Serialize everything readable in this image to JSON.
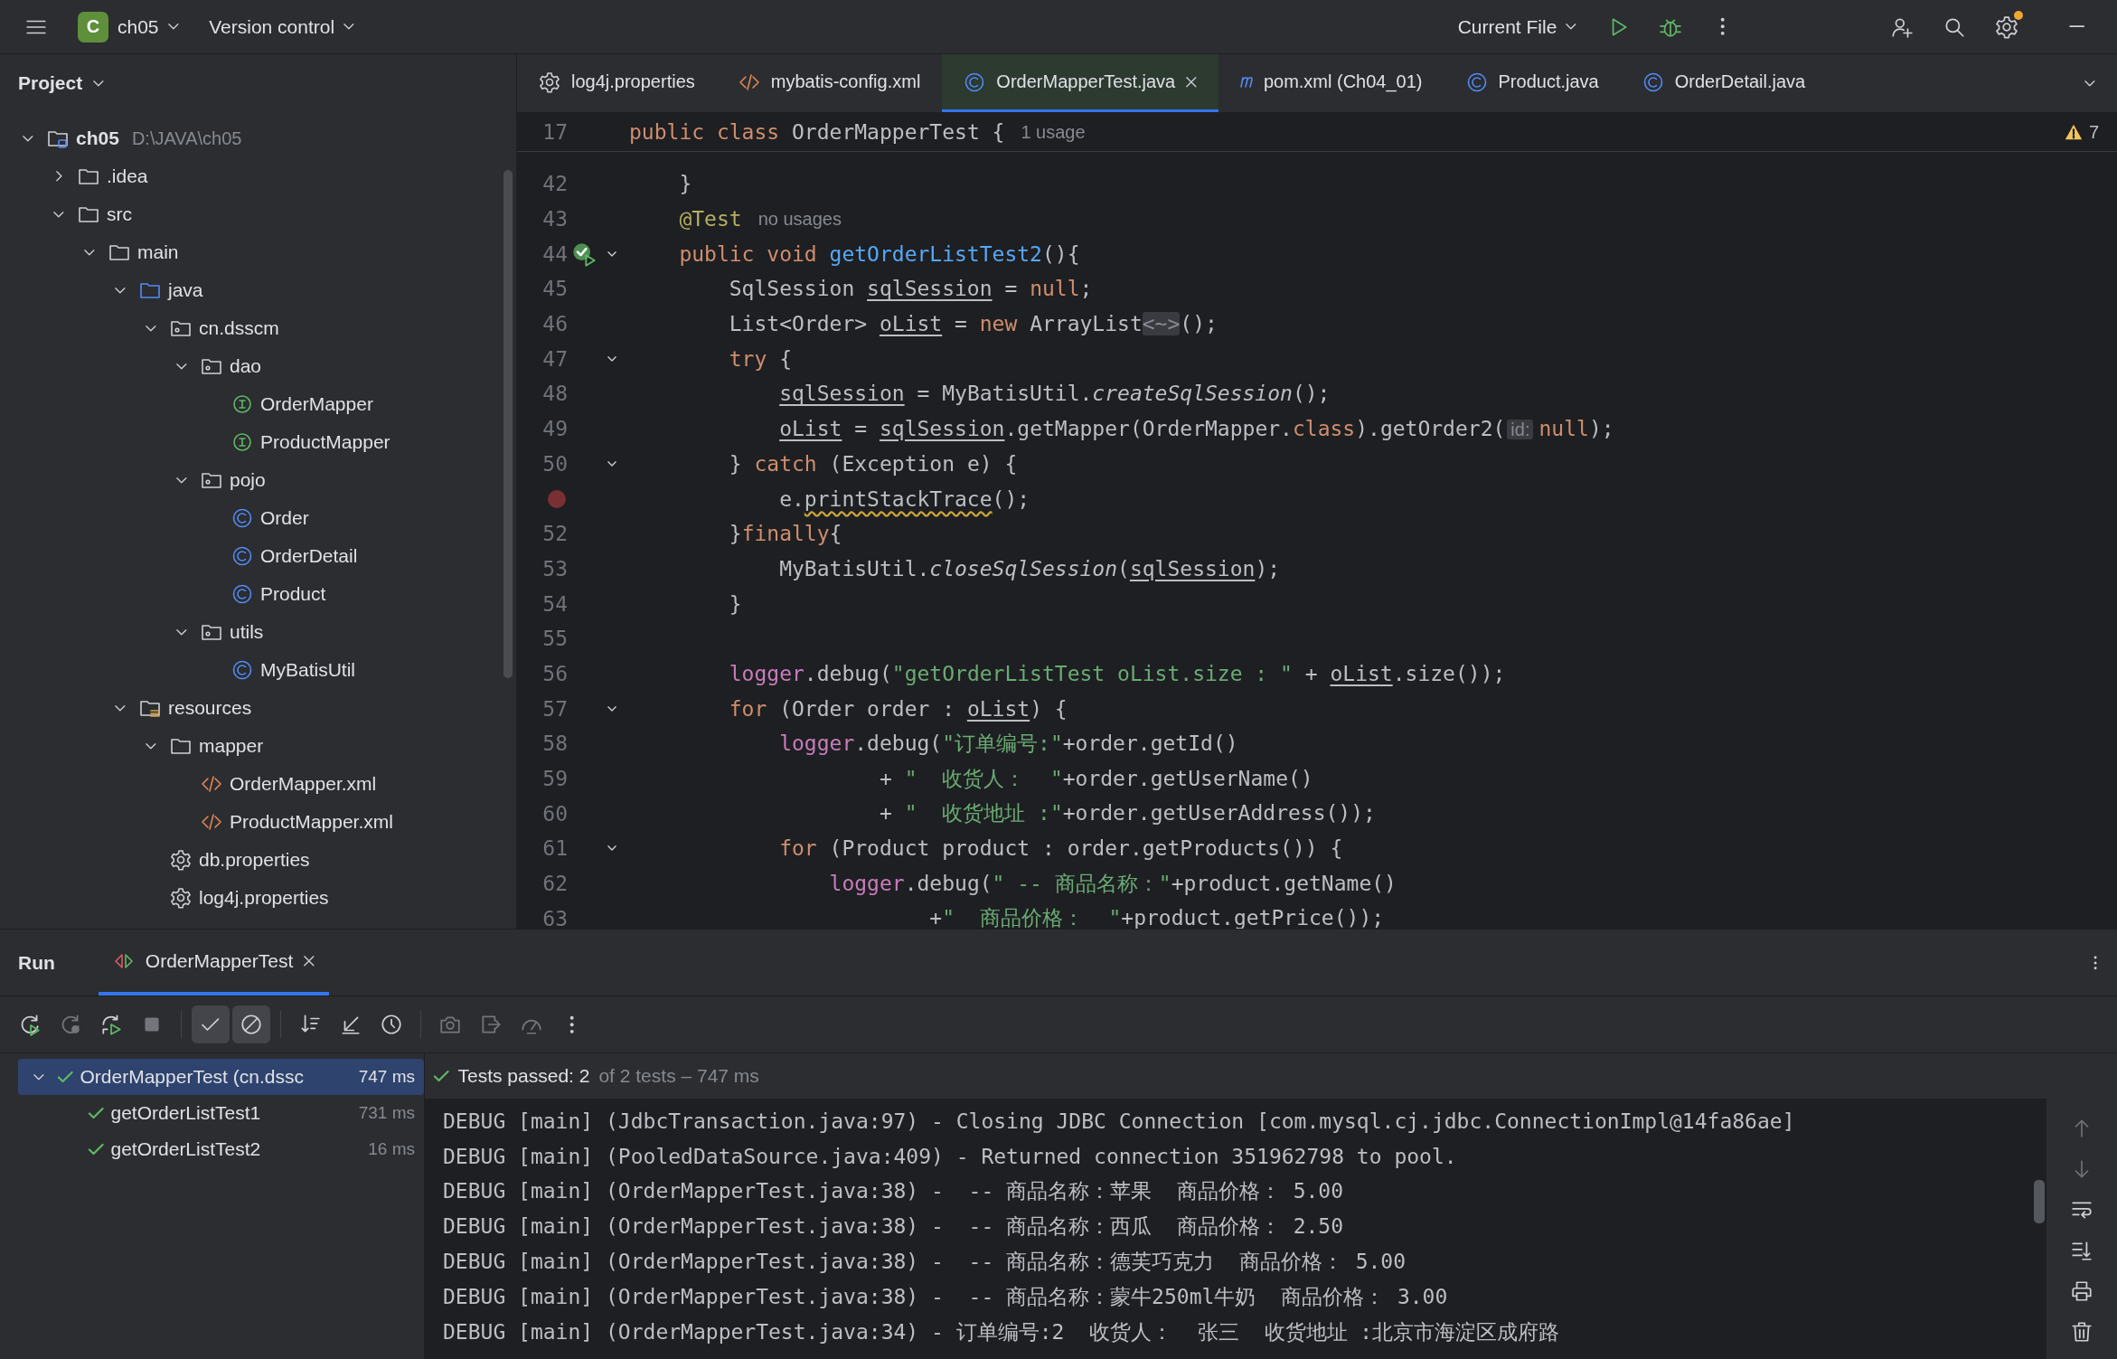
{
  "topbar": {
    "project_badge": "C",
    "project": "ch05",
    "vcs": "Version control",
    "run_config": "Current File",
    "settings_badge": true
  },
  "project_panel": {
    "title": "Project",
    "tree": [
      {
        "label": "ch05",
        "kind": "project",
        "path": "D:\\JAVA\\ch05",
        "expanded": true,
        "children": [
          {
            "label": ".idea",
            "kind": "folder",
            "expanded": false
          },
          {
            "label": "src",
            "kind": "folder",
            "expanded": true,
            "children": [
              {
                "label": "main",
                "kind": "folder",
                "expanded": true,
                "children": [
                  {
                    "label": "java",
                    "kind": "source",
                    "expanded": true,
                    "children": [
                      {
                        "label": "cn.dsscm",
                        "kind": "package",
                        "expanded": true,
                        "children": [
                          {
                            "label": "dao",
                            "kind": "package",
                            "expanded": true,
                            "children": [
                              {
                                "label": "OrderMapper",
                                "kind": "interface"
                              },
                              {
                                "label": "ProductMapper",
                                "kind": "interface"
                              }
                            ]
                          },
                          {
                            "label": "pojo",
                            "kind": "package",
                            "expanded": true,
                            "children": [
                              {
                                "label": "Order",
                                "kind": "class"
                              },
                              {
                                "label": "OrderDetail",
                                "kind": "class"
                              },
                              {
                                "label": "Product",
                                "kind": "class"
                              }
                            ]
                          },
                          {
                            "label": "utils",
                            "kind": "package",
                            "expanded": true,
                            "children": [
                              {
                                "label": "MyBatisUtil",
                                "kind": "class"
                              }
                            ]
                          }
                        ]
                      }
                    ]
                  },
                  {
                    "label": "resources",
                    "kind": "resources",
                    "expanded": true,
                    "children": [
                      {
                        "label": "mapper",
                        "kind": "folder",
                        "expanded": true,
                        "children": [
                          {
                            "label": "OrderMapper.xml",
                            "kind": "xml"
                          },
                          {
                            "label": "ProductMapper.xml",
                            "kind": "xml"
                          }
                        ]
                      },
                      {
                        "label": "db.properties",
                        "kind": "properties"
                      },
                      {
                        "label": "log4j.properties",
                        "kind": "properties"
                      }
                    ]
                  }
                ]
              }
            ]
          }
        ]
      }
    ]
  },
  "editor": {
    "tabs": [
      {
        "label": "log4j.properties",
        "kind": "properties",
        "selected": false
      },
      {
        "label": "mybatis-config.xml",
        "kind": "xml",
        "selected": false
      },
      {
        "label": "OrderMapperTest.java",
        "kind": "class",
        "selected": true
      },
      {
        "label": "pom.xml (Ch04_01)",
        "kind": "maven",
        "selected": false
      },
      {
        "label": "Product.java",
        "kind": "class",
        "selected": false
      },
      {
        "label": "OrderDetail.java",
        "kind": "class",
        "selected": false
      }
    ],
    "warnings": "7",
    "sticky": {
      "number": "17",
      "tokens": [
        {
          "text": "public class ",
          "kind": "kw"
        },
        {
          "text": "OrderMapperTest {",
          "kind": "plain"
        },
        {
          "text": "1 usage",
          "kind": "hint"
        }
      ]
    },
    "lines": [
      {
        "number": "42",
        "kind": "code",
        "fold": false,
        "tokens": [
          {
            "text": "}",
            "kind": "plain"
          }
        ]
      },
      {
        "number": "43",
        "kind": "code",
        "fold": false,
        "tokens": [
          {
            "text": "@Test",
            "kind": "ann"
          },
          {
            "text": "no usages",
            "kind": "hint"
          }
        ]
      },
      {
        "number": "44",
        "kind": "run-test",
        "fold": true,
        "tokens": [
          {
            "text": "public void ",
            "kind": "kw"
          },
          {
            "text": "getOrderListTest2",
            "kind": "decl"
          },
          {
            "text": "(){",
            "kind": "plain"
          }
        ],
        "children": [
          {
            "number": "45",
            "kind": "code",
            "fold": false,
            "tokens": [
              {
                "text": "SqlSession ",
                "kind": "plain"
              },
              {
                "text": "sqlSession",
                "kind": "var"
              },
              {
                "text": " = ",
                "kind": "plain"
              },
              {
                "text": "null",
                "kind": "kw"
              },
              {
                "text": ";",
                "kind": "plain"
              }
            ]
          },
          {
            "number": "46",
            "kind": "code",
            "fold": false,
            "tokens": [
              {
                "text": "List<Order> ",
                "kind": "plain"
              },
              {
                "text": "oList",
                "kind": "var"
              },
              {
                "text": " = ",
                "kind": "plain"
              },
              {
                "text": "new ",
                "kind": "kw"
              },
              {
                "text": "ArrayList",
                "kind": "plain"
              },
              {
                "text": "<~>",
                "kind": "folded"
              },
              {
                "text": "();",
                "kind": "plain"
              }
            ]
          },
          {
            "number": "47",
            "kind": "code",
            "fold": true,
            "tokens": [
              {
                "text": "try ",
                "kind": "kw"
              },
              {
                "text": "{",
                "kind": "plain"
              }
            ],
            "children": [
              {
                "number": "48",
                "kind": "code",
                "fold": false,
                "tokens": [
                  {
                    "text": "sqlSession",
                    "kind": "var"
                  },
                  {
                    "text": " = MyBatisUtil.",
                    "kind": "plain"
                  },
                  {
                    "text": "createSqlSession",
                    "kind": "italic"
                  },
                  {
                    "text": "();",
                    "kind": "plain"
                  }
                ]
              },
              {
                "number": "49",
                "kind": "code",
                "fold": false,
                "tokens": [
                  {
                    "text": "oList",
                    "kind": "var"
                  },
                  {
                    "text": " = ",
                    "kind": "plain"
                  },
                  {
                    "text": "sqlSession",
                    "kind": "var"
                  },
                  {
                    "text": ".getMapper(OrderMapper.",
                    "kind": "plain"
                  },
                  {
                    "text": "class",
                    "kind": "kw"
                  },
                  {
                    "text": ").getOrder2(",
                    "kind": "plain"
                  },
                  {
                    "text": "id:",
                    "kind": "param"
                  },
                  {
                    "text": "null",
                    "kind": "kw"
                  },
                  {
                    "text": ");",
                    "kind": "plain"
                  }
                ]
              }
            ]
          },
          {
            "number": "50",
            "kind": "code",
            "fold": true,
            "tokens": [
              {
                "text": "} ",
                "kind": "plain"
              },
              {
                "text": "catch ",
                "kind": "kw"
              },
              {
                "text": "(Exception e) {",
                "kind": "plain"
              }
            ],
            "children": [
              {
                "kind": "breakpoint",
                "fold": false,
                "tokens": [
                  {
                    "text": "e.",
                    "kind": "plain"
                  },
                  {
                    "text": "printStackTrace",
                    "kind": "warn"
                  },
                  {
                    "text": "();",
                    "kind": "plain"
                  }
                ]
              }
            ]
          },
          {
            "number": "52",
            "kind": "code",
            "fold": false,
            "tokens": [
              {
                "text": "}",
                "kind": "plain"
              },
              {
                "text": "finally",
                "kind": "kw"
              },
              {
                "text": "{",
                "kind": "plain"
              }
            ],
            "children": [
              {
                "number": "53",
                "kind": "code",
                "fold": false,
                "tokens": [
                  {
                    "text": "MyBatisUtil.",
                    "kind": "plain"
                  },
                  {
                    "text": "closeSqlSession",
                    "kind": "italic"
                  },
                  {
                    "text": "(",
                    "kind": "plain"
                  },
                  {
                    "text": "sqlSession",
                    "kind": "var"
                  },
                  {
                    "text": ");",
                    "kind": "plain"
                  }
                ]
              }
            ]
          },
          {
            "number": "54",
            "kind": "code",
            "fold": false,
            "tokens": [
              {
                "text": "}",
                "kind": "plain"
              }
            ]
          },
          {
            "number": "55",
            "kind": "code",
            "fold": false
          },
          {
            "number": "56",
            "kind": "code",
            "fold": false,
            "tokens": [
              {
                "text": "logger",
                "kind": "static"
              },
              {
                "text": ".debug(",
                "kind": "plain"
              },
              {
                "text": "\"getOrderListTest oList.size : \"",
                "kind": "str"
              },
              {
                "text": " + ",
                "kind": "plain"
              },
              {
                "text": "oList",
                "kind": "var"
              },
              {
                "text": ".size());",
                "kind": "plain"
              }
            ]
          },
          {
            "number": "57",
            "kind": "code",
            "fold": true,
            "tokens": [
              {
                "text": "for ",
                "kind": "kw"
              },
              {
                "text": "(Order order : ",
                "kind": "plain"
              },
              {
                "text": "oList",
                "kind": "var"
              },
              {
                "text": ") {",
                "kind": "plain"
              }
            ],
            "children": [
              {
                "number": "58",
                "kind": "code",
                "fold": false,
                "tokens": [
                  {
                    "text": "logger",
                    "kind": "static"
                  },
                  {
                    "text": ".debug(",
                    "kind": "plain"
                  },
                  {
                    "text": "\"订单编号:\"",
                    "kind": "str"
                  },
                  {
                    "text": "+order.getId()",
                    "kind": "plain"
                  }
                ],
                "children": [
                  {
                    "number": "59",
                    "kind": "code",
                    "fold": false,
                    "tokens": [
                      {
                        "text": "    + ",
                        "kind": "plain"
                      },
                      {
                        "text": "\"  收货人：  \"",
                        "kind": "str"
                      },
                      {
                        "text": "+order.getUserName()",
                        "kind": "plain"
                      }
                    ]
                  },
                  {
                    "number": "60",
                    "kind": "code",
                    "fold": false,
                    "tokens": [
                      {
                        "text": "    + ",
                        "kind": "plain"
                      },
                      {
                        "text": "\"  收货地址 :\"",
                        "kind": "str"
                      },
                      {
                        "text": "+order.getUserAddress());",
                        "kind": "plain"
                      }
                    ]
                  }
                ]
              },
              {
                "number": "61",
                "kind": "code",
                "fold": true,
                "tokens": [
                  {
                    "text": "for ",
                    "kind": "kw"
                  },
                  {
                    "text": "(Product product : order.getProducts()) {",
                    "kind": "plain"
                  }
                ],
                "children": [
                  {
                    "number": "62",
                    "kind": "code",
                    "fold": false,
                    "tokens": [
                      {
                        "text": "logger",
                        "kind": "static"
                      },
                      {
                        "text": ".debug(",
                        "kind": "plain"
                      },
                      {
                        "text": "\" -- 商品名称：\"",
                        "kind": "str"
                      },
                      {
                        "text": "+product.getName()",
                        "kind": "plain"
                      }
                    ],
                    "children": [
                      {
                        "number": "63",
                        "kind": "code",
                        "fold": false,
                        "tokens": [
                          {
                            "text": "    +",
                            "kind": "plain"
                          },
                          {
                            "text": "\"  商品价格：  \"",
                            "kind": "str"
                          },
                          {
                            "text": "+product.getPrice());",
                            "kind": "plain"
                          }
                        ]
                      }
                    ]
                  }
                ]
              }
            ]
          }
        ]
      }
    ]
  },
  "run_panel": {
    "title": "Run",
    "tabs": [
      {
        "label": "OrderMapperTest",
        "selected": true
      }
    ],
    "toolbar": [
      {
        "kind": "rerun",
        "on": false,
        "disabled": false
      },
      {
        "kind": "rerun-failed",
        "on": false,
        "disabled": true
      },
      {
        "kind": "toggle-auto",
        "on": false,
        "disabled": false
      },
      {
        "kind": "stop",
        "on": false,
        "disabled": true
      },
      {
        "kind": "show-passed",
        "on": true,
        "disabled": false
      },
      {
        "kind": "show-ignored",
        "on": true,
        "disabled": false
      },
      {
        "kind": "sort",
        "on": false,
        "disabled": false
      },
      {
        "kind": "import",
        "on": false,
        "disabled": false
      },
      {
        "kind": "history",
        "on": false,
        "disabled": false
      },
      {
        "kind": "camera",
        "on": false,
        "disabled": true
      },
      {
        "kind": "export",
        "on": false,
        "disabled": true
      },
      {
        "kind": "gauge",
        "on": false,
        "disabled": true
      },
      {
        "kind": "more",
        "on": false,
        "disabled": false
      }
    ],
    "tests": [
      {
        "name": "OrderMapperTest (cn.dssc",
        "time": "747 ms",
        "passed": true,
        "selected": true,
        "expanded": true,
        "children": [
          {
            "name": "getOrderListTest1",
            "time": "731 ms",
            "passed": true,
            "selected": false
          },
          {
            "name": "getOrderListTest2",
            "time": "16 ms",
            "passed": true,
            "selected": false
          }
        ]
      }
    ],
    "summary": {
      "passed": true,
      "result": "Tests passed: 2",
      "detail": "of 2 tests – 747 ms"
    },
    "console": [
      "DEBUG [main] (JdbcTransaction.java:97) - Closing JDBC Connection [com.mysql.cj.jdbc.ConnectionImpl@14fa86ae]",
      "DEBUG [main] (PooledDataSource.java:409) - Returned connection 351962798 to pool.",
      "DEBUG [main] (OrderMapperTest.java:38) -  -- 商品名称：苹果  商品价格： 5.00",
      "DEBUG [main] (OrderMapperTest.java:38) -  -- 商品名称：西瓜  商品价格： 2.50",
      "DEBUG [main] (OrderMapperTest.java:38) -  -- 商品名称：德芙巧克力  商品价格： 5.00",
      "DEBUG [main] (OrderMapperTest.java:38) -  -- 商品名称：蒙牛250ml牛奶  商品价格： 3.00",
      "DEBUG [main] (OrderMapperTest.java:34) - 订单编号:2  收货人：  张三  收货地址 :北京市海淀区成府路"
    ]
  }
}
